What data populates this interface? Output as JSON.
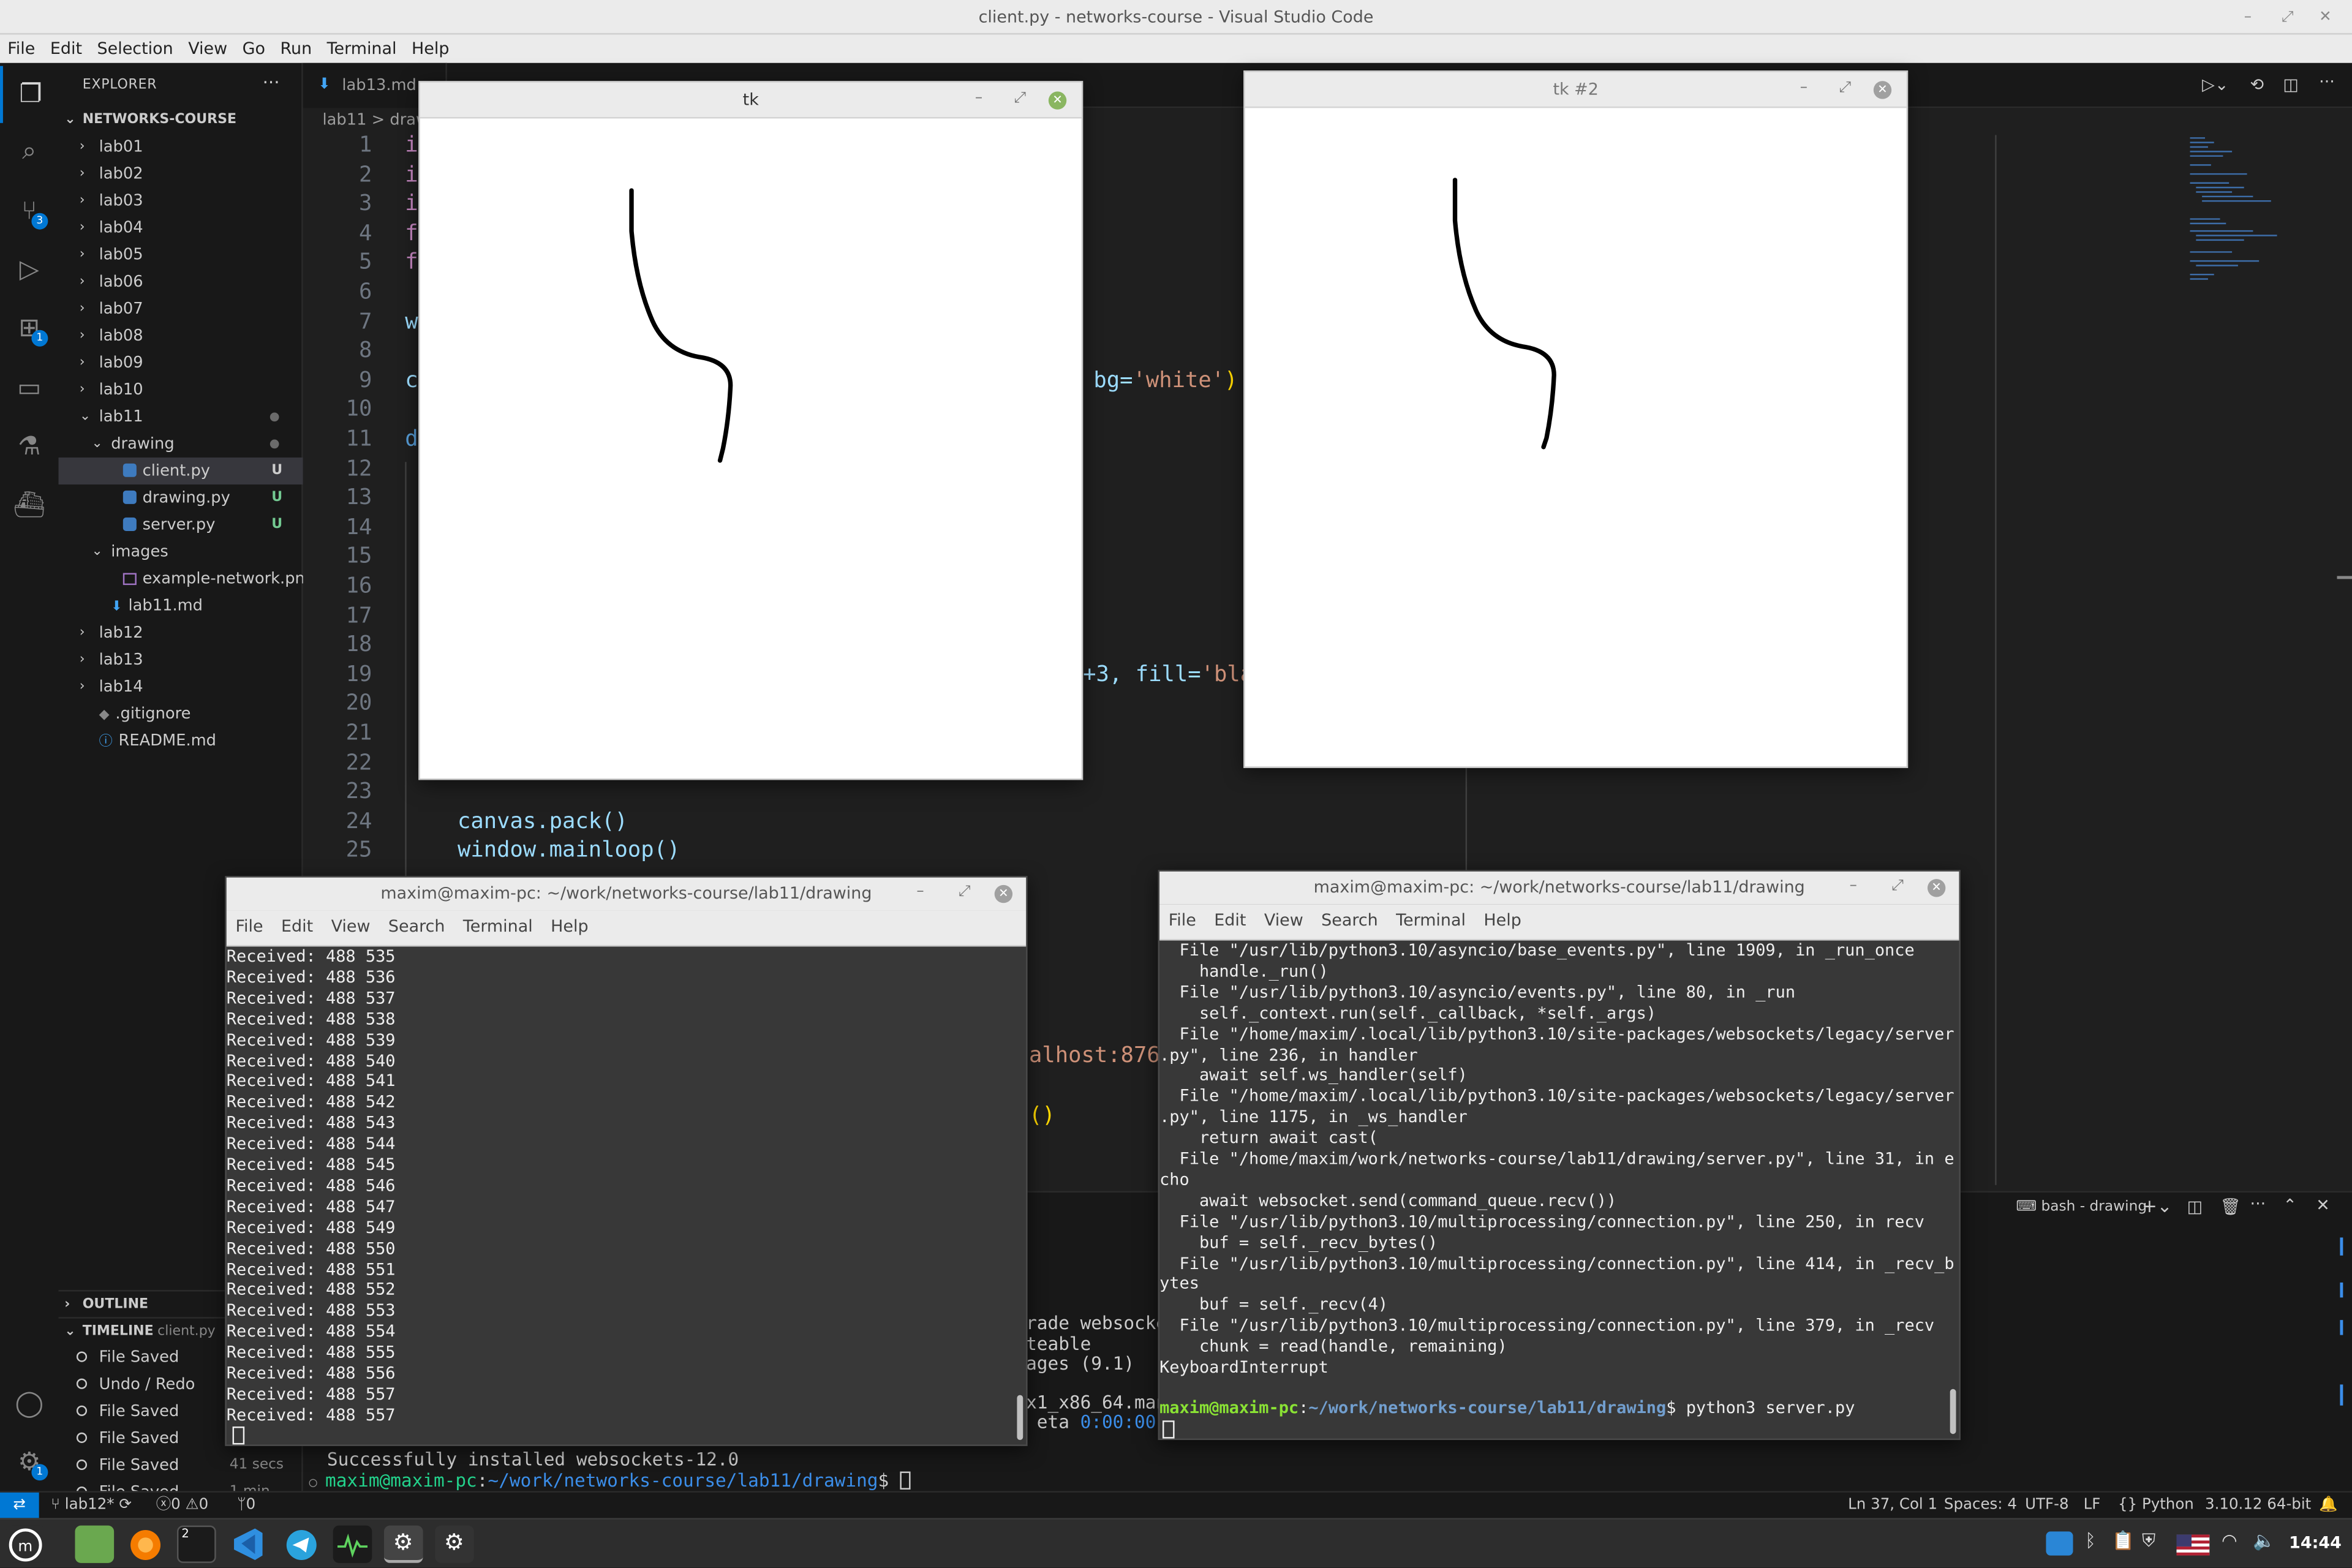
{
  "window": {
    "title": "client.py - networks-course - Visual Studio Code"
  },
  "menubar": [
    "File",
    "Edit",
    "Selection",
    "View",
    "Go",
    "Run",
    "Terminal",
    "Help"
  ],
  "explorer": {
    "header": "EXPLORER",
    "root": "NETWORKS-COURSE",
    "items": [
      {
        "label": "lab01",
        "kind": "folder"
      },
      {
        "label": "lab02",
        "kind": "folder"
      },
      {
        "label": "lab03",
        "kind": "folder"
      },
      {
        "label": "lab04",
        "kind": "folder"
      },
      {
        "label": "lab05",
        "kind": "folder"
      },
      {
        "label": "lab06",
        "kind": "folder"
      },
      {
        "label": "lab07",
        "kind": "folder"
      },
      {
        "label": "lab08",
        "kind": "folder"
      },
      {
        "label": "lab09",
        "kind": "folder"
      },
      {
        "label": "lab10",
        "kind": "folder"
      },
      {
        "label": "lab11",
        "kind": "folder-open"
      },
      {
        "label": "drawing",
        "kind": "folder-open"
      },
      {
        "label": "client.py",
        "kind": "py",
        "status": "U"
      },
      {
        "label": "drawing.py",
        "kind": "py",
        "status": "U"
      },
      {
        "label": "server.py",
        "kind": "py",
        "status": "U"
      },
      {
        "label": "images",
        "kind": "folder-open"
      },
      {
        "label": "example-network.png",
        "kind": "img"
      },
      {
        "label": "lab11.md",
        "kind": "md"
      },
      {
        "label": "lab12",
        "kind": "folder"
      },
      {
        "label": "lab13",
        "kind": "folder"
      },
      {
        "label": "lab14",
        "kind": "folder"
      },
      {
        "label": ".gitignore",
        "kind": "git"
      },
      {
        "label": "README.md",
        "kind": "info"
      }
    ],
    "outline": "OUTLINE",
    "timeline": "TIMELINE",
    "timeline_file": "client.py",
    "timeline_items": [
      {
        "label": "File Saved",
        "time": ""
      },
      {
        "label": "Undo / Redo",
        "time": ""
      },
      {
        "label": "File Saved",
        "time": ""
      },
      {
        "label": "File Saved",
        "time": ""
      },
      {
        "label": "File Saved",
        "time": "41 secs"
      },
      {
        "label": "File Saved",
        "time": "1 min"
      }
    ]
  },
  "activity_badges": {
    "scm": "3",
    "extensions": "1",
    "settings": "1"
  },
  "tabs": {
    "first": "lab13.md"
  },
  "breadcrumb": "lab11 > draw",
  "editor": {
    "line_numbers": [
      "1",
      "2",
      "3",
      "4",
      "5",
      "6",
      "7",
      "8",
      "9",
      "10",
      "11",
      "12",
      "13",
      "14",
      "15",
      "16",
      "17",
      "18",
      "19",
      "20",
      "21",
      "22",
      "23",
      "24",
      "25"
    ],
    "visible_fragments": {
      "l1": "i",
      "l2": "i",
      "l3": "i",
      "l4": "f",
      "l5": "f",
      "l7": "w",
      "l9": "c",
      "l11": "d",
      "l9_tail_kw": "bg=",
      "l9_tail_str": "'white'",
      "l9_tail_paren": ")",
      "l19_tail": "+3, fill=",
      "l19_tail_str": "'bla",
      "l24": "canvas.pack()",
      "l25": "window.mainloop()",
      "frag_localhost": "alhost:876",
      "frag_paren": "()"
    }
  },
  "tk1": {
    "title": "tk"
  },
  "tk2": {
    "title": "tk #2"
  },
  "term1": {
    "title": "maxim@maxim-pc: ~/work/networks-course/lab11/drawing",
    "menu": [
      "File",
      "Edit",
      "View",
      "Search",
      "Terminal",
      "Help"
    ],
    "lines": [
      "Received: 488 535",
      "Received: 488 536",
      "Received: 488 537",
      "Received: 488 538",
      "Received: 488 539",
      "Received: 488 540",
      "Received: 488 541",
      "Received: 488 542",
      "Received: 488 543",
      "Received: 488 544",
      "Received: 488 545",
      "Received: 488 546",
      "Received: 488 547",
      "Received: 488 549",
      "Received: 488 550",
      "Received: 488 551",
      "Received: 488 552",
      "Received: 488 553",
      "Received: 488 554",
      "Received: 488 555",
      "Received: 488 556",
      "Received: 488 557",
      "Received: 488 557"
    ]
  },
  "term2": {
    "title": "maxim@maxim-pc: ~/work/networks-course/lab11/drawing",
    "menu": [
      "File",
      "Edit",
      "View",
      "Search",
      "Terminal",
      "Help"
    ],
    "lines": [
      "  File \"/usr/lib/python3.10/asyncio/base_events.py\", line 1909, in _run_once",
      "    handle._run()",
      "  File \"/usr/lib/python3.10/asyncio/events.py\", line 80, in _run",
      "    self._context.run(self._callback, *self._args)",
      "  File \"/home/maxim/.local/lib/python3.10/site-packages/websockets/legacy/server",
      ".py\", line 236, in handler",
      "    await self.ws_handler(self)",
      "  File \"/home/maxim/.local/lib/python3.10/site-packages/websockets/legacy/server",
      ".py\", line 1175, in _ws_handler",
      "    return await cast(",
      "  File \"/home/maxim/work/networks-course/lab11/drawing/server.py\", line 31, in e",
      "cho",
      "    await websocket.send(command_queue.recv())",
      "  File \"/usr/lib/python3.10/multiprocessing/connection.py\", line 250, in recv",
      "    buf = self._recv_bytes()",
      "  File \"/usr/lib/python3.10/multiprocessing/connection.py\", line 414, in _recv_b",
      "ytes",
      "    buf = self._recv(4)",
      "  File \"/usr/lib/python3.10/multiprocessing/connection.py\", line 379, in _recv",
      "    chunk = read(handle, remaining)",
      "KeyboardInterrupt"
    ],
    "prompt_user": "maxim@maxim-pc",
    "prompt_path": "~/work/networks-course/lab11/drawing",
    "prompt_cmd": "$ python3 server.py"
  },
  "panel": {
    "terminal_name": "bash - drawing",
    "frag1": "rade websocket",
    "frag2": "teable",
    "frag3": "ages (9.1)",
    "frag4": "x1_x86_64.many",
    "frag5_a": " eta ",
    "frag5_b": "0:00:00",
    "installed": "Successfully installed websockets-12.0",
    "prompt_user": "maxim@maxim-pc",
    "prompt_path": "~/work/networks-course/lab11/drawing",
    "prompt_end": "$ "
  },
  "statusbar": {
    "branch": "lab12*",
    "errors": "0",
    "warnings": "0",
    "ports": "0",
    "position": "Ln 37, Col 1",
    "spaces": "Spaces: 4",
    "encoding": "UTF-8",
    "eol": "LF",
    "language": "Python",
    "interpreter": "3.10.12 64-bit"
  },
  "taskbar": {
    "clock": "14:44",
    "term_badge": "2"
  }
}
